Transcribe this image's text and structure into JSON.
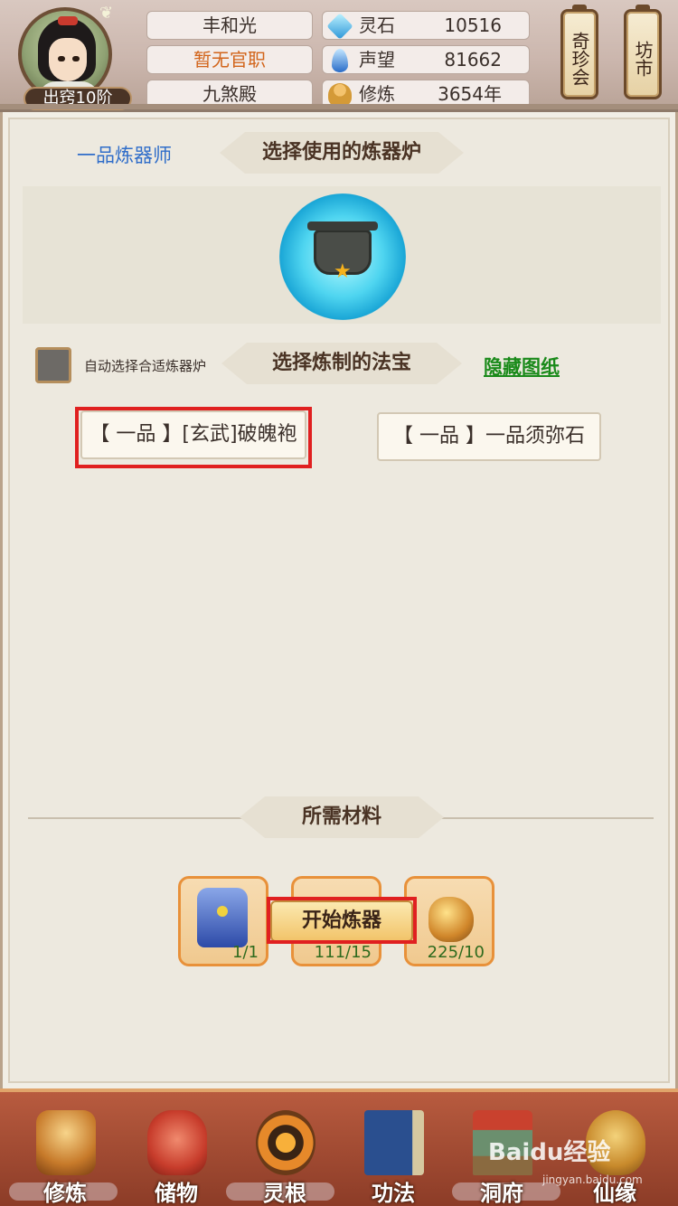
{
  "header": {
    "player_name": "丰和光",
    "official_title": "暂无官职",
    "sect": "九煞殿",
    "rank_badge": "出窍10阶",
    "resources": [
      {
        "label": "灵石",
        "value": "10516",
        "icon": "spirit-stone-icon"
      },
      {
        "label": "声望",
        "value": "81662",
        "icon": "reputation-icon"
      },
      {
        "label": "修炼",
        "value": "3654年",
        "icon": "cultivation-icon"
      }
    ],
    "lanterns": [
      {
        "label": "奇珍会"
      },
      {
        "label": "坊市"
      }
    ]
  },
  "refine": {
    "refiner_rank": "一品炼器师",
    "furnace_section_title": "选择使用的炼器炉",
    "auto_select_label": "自动选择合适炼器炉",
    "artifact_section_title": "选择炼制的法宝",
    "hide_blueprint_link": "隐藏图纸",
    "artifacts": [
      {
        "label": "【 一品 】[玄武]破魄袍",
        "selected": true
      },
      {
        "label": "【 一品 】一品须弥石",
        "selected": false
      }
    ],
    "materials_title": "所需材料",
    "materials": [
      {
        "icon": "armor-robe-icon",
        "qty": "1/1"
      },
      {
        "icon": "grey-ore-icon",
        "qty": "111/15"
      },
      {
        "icon": "gold-ore-icon",
        "qty": "225/10"
      }
    ],
    "start_button": "开始炼器"
  },
  "bottom_nav": [
    {
      "label": "修炼",
      "icon": "cultivate-monk-icon"
    },
    {
      "label": "储物",
      "icon": "storage-bag-icon"
    },
    {
      "label": "灵根",
      "icon": "spirit-root-icon"
    },
    {
      "label": "功法",
      "icon": "technique-book-icon"
    },
    {
      "label": "洞府",
      "icon": "cave-mansion-icon"
    },
    {
      "label": "仙缘",
      "icon": "immortal-fate-icon"
    }
  ],
  "watermark": {
    "brand": "Baidu经验",
    "url": "jingyan.baidu.com"
  }
}
